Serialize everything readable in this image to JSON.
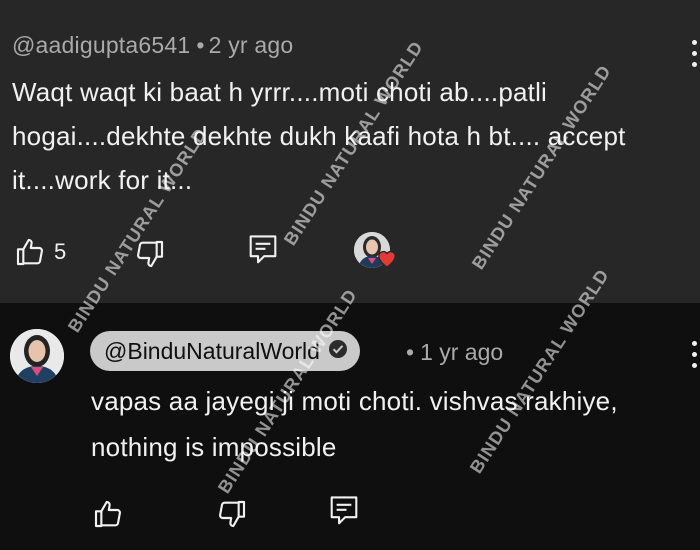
{
  "comment": {
    "author": "@aadigupta6541",
    "separator": "•",
    "time": "2 yr ago",
    "text": "Waqt waqt ki baat h yrrr....moti choti ab....patli hogai....dekhte dekhte dukh kaafi hota h bt.... accept it....work for it...",
    "likes": "5",
    "icons": [
      "thumbs-up-icon",
      "thumbs-down-icon",
      "reply-icon",
      "creator-heart-icon",
      "more-vert-icon"
    ]
  },
  "reply": {
    "author": "@BinduNaturalWorld",
    "verified_icon": "check-circle-icon",
    "separator": "•",
    "time": "1 yr ago",
    "text": "vapas aa jayegi ji moti choti. vishvas rakhiye, nothing is impossible",
    "icons": [
      "thumbs-up-icon",
      "thumbs-down-icon",
      "reply-icon",
      "more-vert-icon"
    ]
  },
  "watermark": "BINDU NATURAL WORLD",
  "colors": {
    "top_bg": "#272727",
    "bottom_bg": "#0f0f0f",
    "pill_bg": "#c9c9c9",
    "heart": "#e53935",
    "muted_text": "#aaaaaa"
  }
}
